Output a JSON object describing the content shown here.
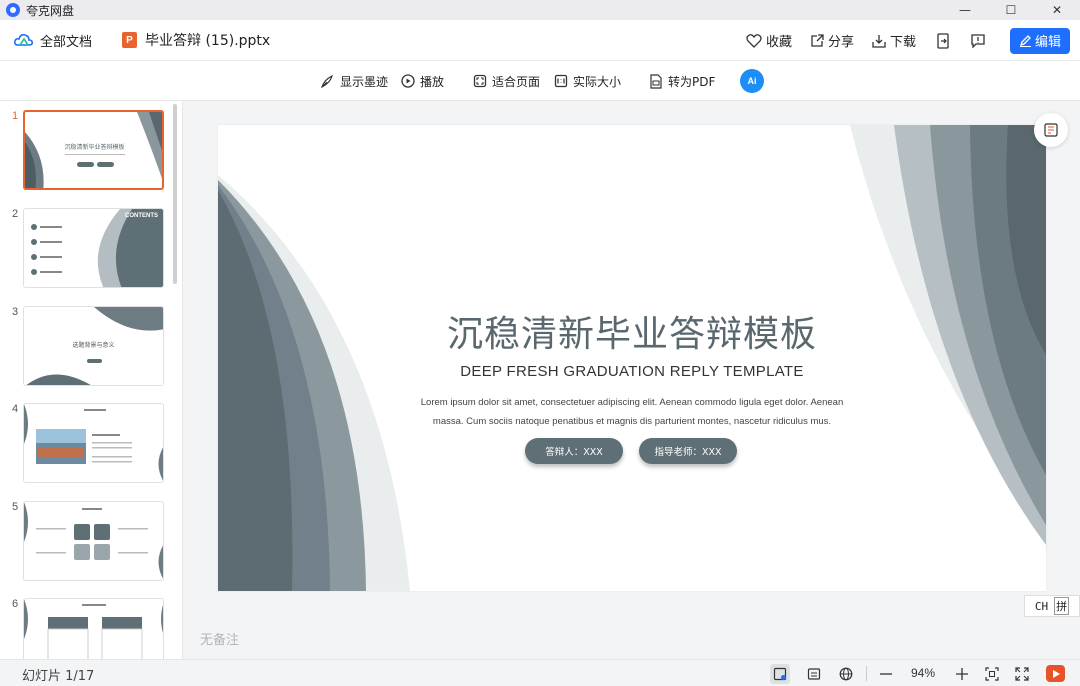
{
  "app": {
    "title": "夸克网盘"
  },
  "window": {
    "minimize": "—",
    "maximize": "☐",
    "close": "✕"
  },
  "header": {
    "all_docs": "全部文档",
    "file_name": "毕业答辩 (15).pptx",
    "file_type_letter": "P",
    "favorite": "收藏",
    "share": "分享",
    "download": "下载",
    "edit": "编辑"
  },
  "toolbar": {
    "show_ink": "显示墨迹",
    "play": "播放",
    "fit_page": "适合页面",
    "actual_size": "实际大小",
    "to_pdf": "转为PDF",
    "ai_label": "Ai"
  },
  "thumbnails": [
    {
      "num": "1",
      "title": "沉稳清新毕业答辩模板"
    },
    {
      "num": "2",
      "title": "CONTENTS"
    },
    {
      "num": "3",
      "title": "选题背景与意义"
    },
    {
      "num": "4",
      "title": ""
    },
    {
      "num": "5",
      "title": ""
    },
    {
      "num": "6",
      "title": ""
    }
  ],
  "slide": {
    "title": "沉稳清新毕业答辩模板",
    "subtitle": "DEEP FRESH GRADUATION REPLY TEMPLATE",
    "body_line1": "Lorem ipsum dolor sit amet, consectetuer adipiscing elit. Aenean commodo ligula eget dolor. Aenean",
    "body_line2": "massa. Cum sociis natoque penatibus et magnis dis parturient montes, nascetur ridiculus mus.",
    "presenter": "答辩人：XXX",
    "advisor": "指导老师：XXX"
  },
  "ime": {
    "lang": "CH",
    "mode": "拼"
  },
  "notes": {
    "placeholder": "无备注"
  },
  "status": {
    "slide_count": "幻灯片 1/17",
    "zoom": "94%"
  },
  "colors": {
    "accent": "#1f6fff",
    "ppt": "#e8642c",
    "slide_gray": "#5f6f76"
  }
}
